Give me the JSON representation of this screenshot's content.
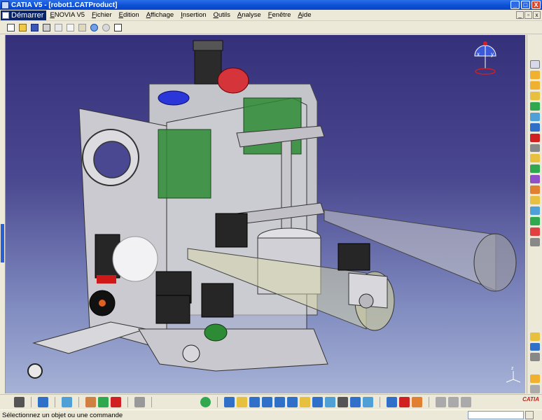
{
  "window": {
    "title": "CATIA V5 - [robot1.CATProduct]",
    "minimize_label": "_",
    "maximize_label": "□",
    "close_label": "X"
  },
  "menu": {
    "start_label": "Démarrer",
    "items": [
      "ENOVIA V5",
      "Fichier",
      "Edition",
      "Affichage",
      "Insertion",
      "Outils",
      "Analyse",
      "Fenêtre",
      "Aide"
    ],
    "doc_minimize": "_",
    "doc_restore": "▫",
    "doc_close": "x"
  },
  "viewport": {
    "document": "robot1.CATProduct",
    "compass_x_label": "x",
    "compass_y_label": "y",
    "axis_label": "z"
  },
  "brand": {
    "logo_text": "CATIA"
  },
  "status": {
    "message": "Sélectionnez un objet ou une commande",
    "command_value": ""
  },
  "colors": {
    "titlebar": "#0b4fd6",
    "viewport_top": "#35307a",
    "viewport_bottom": "#a6b2d6",
    "part_green": "#2e8b35",
    "part_gray": "#c9c9cf"
  }
}
